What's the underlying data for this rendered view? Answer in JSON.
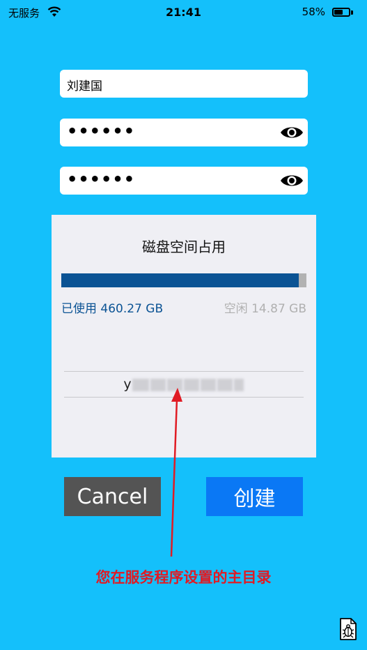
{
  "status_bar": {
    "carrier": "无服务",
    "time": "21:41",
    "battery": "58%",
    "battery_level": 0.58,
    "wifi_icon": "wifi-icon",
    "battery_icon": "battery-icon"
  },
  "form": {
    "username": "刘建国",
    "password": "••••••",
    "confirm_password": "••••••",
    "eye_icon": "eye-icon"
  },
  "disk": {
    "title": "磁盘空间占用",
    "used_label": "已使用 460.27 GB",
    "free_label": "空闲 14.87 GB",
    "used_fraction": 0.969,
    "used_color": "#0b5394",
    "free_color": "#b2b2b2",
    "path_visible": "y"
  },
  "buttons": {
    "cancel": "Cancel",
    "create": "创建"
  },
  "annotation": {
    "text": "您在服务程序设置的主目录",
    "color": "#e01b24"
  },
  "colors": {
    "background": "#14c0fb",
    "create_button": "#0a78f5",
    "cancel_button": "#545454"
  },
  "debug_icon": "bug-icon"
}
